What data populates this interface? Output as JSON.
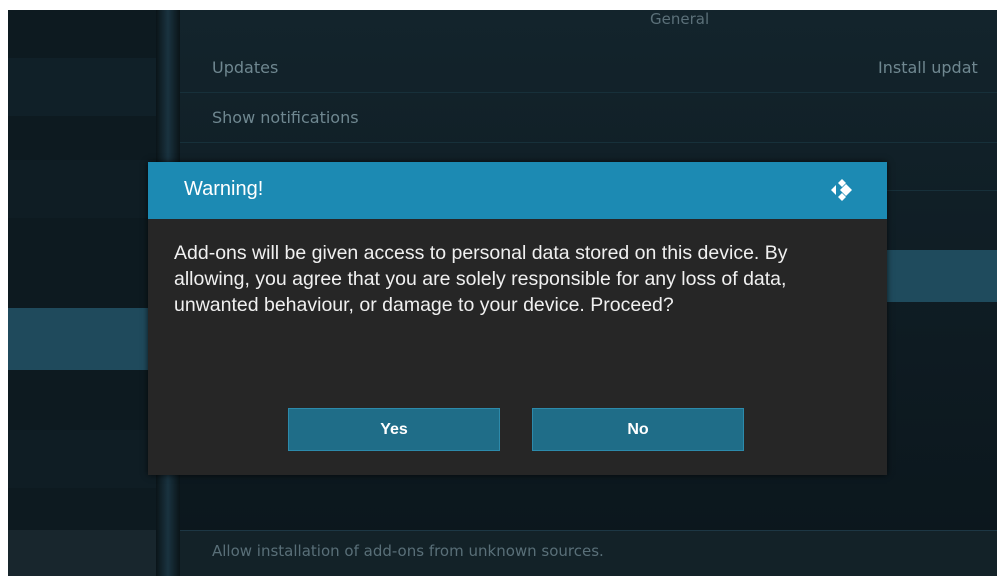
{
  "background_settings": {
    "section_header": "General",
    "updates_label": "Updates",
    "updates_value": "Install updat",
    "notifications_label": "Show notifications",
    "unknown_sources_description": "Allow installation of add-ons from unknown sources."
  },
  "dialog": {
    "title": "Warning!",
    "message": "Add-ons will be given access to personal data stored on this device. By allowing, you agree that you are solely responsible for any loss of data, unwanted behaviour, or damage to your device. Proceed?",
    "yes_label": "Yes",
    "no_label": "No",
    "logo_icon": "kodi-logo-icon"
  },
  "colors": {
    "dialog_header": "#1c8ab3",
    "dialog_body": "#262626",
    "button": "#1f6d88",
    "highlight": "#1f4b5d"
  }
}
